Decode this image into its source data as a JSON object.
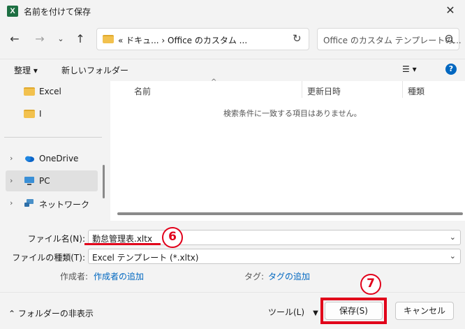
{
  "window": {
    "title": "名前を付けて保存",
    "app_icon_letter": "X"
  },
  "nav": {
    "address_path": "« ドキュ...  ›  Office のカスタム ...",
    "search_placeholder": "Office のカスタム テンプレートの..."
  },
  "toolbar": {
    "organize_label": "整理 ▾",
    "new_folder_label": "新しいフォルダー"
  },
  "sidebar": {
    "items": [
      {
        "label": "Excel",
        "icon": "folder-icon"
      },
      {
        "label": "I",
        "icon": "folder-icon"
      },
      {
        "label": "OneDrive",
        "icon": "cloud-icon"
      },
      {
        "label": "PC",
        "icon": "computer-icon",
        "selected": true
      },
      {
        "label": "ネットワーク",
        "icon": "network-icon"
      }
    ]
  },
  "file_list": {
    "columns": [
      "名前",
      "更新日時",
      "種類"
    ],
    "empty_message": "検索条件に一致する項目はありません。"
  },
  "form": {
    "filename_label": "ファイル名(N):",
    "filename_value": "勤怠管理表.xltx",
    "filetype_label": "ファイルの種類(T):",
    "filetype_value": "Excel テンプレート (*.xltx)",
    "author_label": "作成者:",
    "author_link": "作成者の追加",
    "tags_label": "タグ:",
    "tags_link": "タグの追加"
  },
  "bottom": {
    "hide_folders_label": "フォルダーの非表示",
    "tools_label": "ツール(L)",
    "save_label": "保存(S)",
    "cancel_label": "キャンセル"
  },
  "annotations": {
    "step6": "6",
    "step7": "7"
  },
  "colors": {
    "accent": "#0067c0",
    "annotation_red": "#e1001a",
    "excel_green": "#1d6f42"
  }
}
